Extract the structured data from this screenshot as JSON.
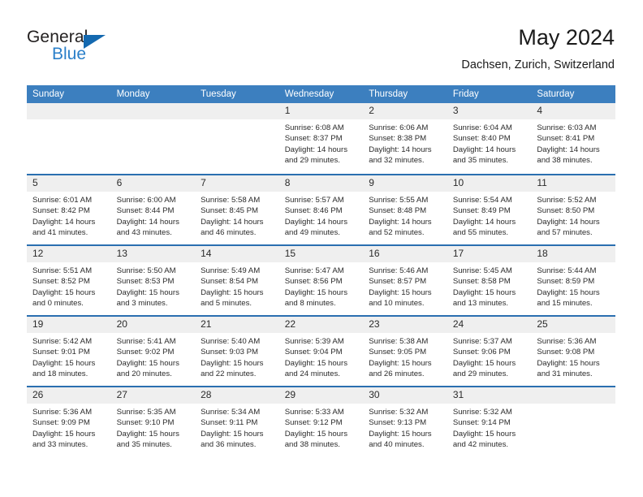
{
  "brand": {
    "name_part1": "General",
    "name_part2": "Blue",
    "accent_color": "#2a7fc9",
    "triangle_color": "#1469b0"
  },
  "header": {
    "title": "May 2024",
    "subtitle": "Dachsen, Zurich, Switzerland"
  },
  "calendar": {
    "header_color": "#3c7fbf",
    "row_divider_color": "#2a6fb0",
    "daynum_bg": "#efefef",
    "weekday_headers": [
      "Sunday",
      "Monday",
      "Tuesday",
      "Wednesday",
      "Thursday",
      "Friday",
      "Saturday"
    ],
    "weeks": [
      [
        {
          "day": "",
          "lines": []
        },
        {
          "day": "",
          "lines": []
        },
        {
          "day": "",
          "lines": []
        },
        {
          "day": "1",
          "lines": [
            "Sunrise: 6:08 AM",
            "Sunset: 8:37 PM",
            "Daylight: 14 hours",
            "and 29 minutes."
          ]
        },
        {
          "day": "2",
          "lines": [
            "Sunrise: 6:06 AM",
            "Sunset: 8:38 PM",
            "Daylight: 14 hours",
            "and 32 minutes."
          ]
        },
        {
          "day": "3",
          "lines": [
            "Sunrise: 6:04 AM",
            "Sunset: 8:40 PM",
            "Daylight: 14 hours",
            "and 35 minutes."
          ]
        },
        {
          "day": "4",
          "lines": [
            "Sunrise: 6:03 AM",
            "Sunset: 8:41 PM",
            "Daylight: 14 hours",
            "and 38 minutes."
          ]
        }
      ],
      [
        {
          "day": "5",
          "lines": [
            "Sunrise: 6:01 AM",
            "Sunset: 8:42 PM",
            "Daylight: 14 hours",
            "and 41 minutes."
          ]
        },
        {
          "day": "6",
          "lines": [
            "Sunrise: 6:00 AM",
            "Sunset: 8:44 PM",
            "Daylight: 14 hours",
            "and 43 minutes."
          ]
        },
        {
          "day": "7",
          "lines": [
            "Sunrise: 5:58 AM",
            "Sunset: 8:45 PM",
            "Daylight: 14 hours",
            "and 46 minutes."
          ]
        },
        {
          "day": "8",
          "lines": [
            "Sunrise: 5:57 AM",
            "Sunset: 8:46 PM",
            "Daylight: 14 hours",
            "and 49 minutes."
          ]
        },
        {
          "day": "9",
          "lines": [
            "Sunrise: 5:55 AM",
            "Sunset: 8:48 PM",
            "Daylight: 14 hours",
            "and 52 minutes."
          ]
        },
        {
          "day": "10",
          "lines": [
            "Sunrise: 5:54 AM",
            "Sunset: 8:49 PM",
            "Daylight: 14 hours",
            "and 55 minutes."
          ]
        },
        {
          "day": "11",
          "lines": [
            "Sunrise: 5:52 AM",
            "Sunset: 8:50 PM",
            "Daylight: 14 hours",
            "and 57 minutes."
          ]
        }
      ],
      [
        {
          "day": "12",
          "lines": [
            "Sunrise: 5:51 AM",
            "Sunset: 8:52 PM",
            "Daylight: 15 hours",
            "and 0 minutes."
          ]
        },
        {
          "day": "13",
          "lines": [
            "Sunrise: 5:50 AM",
            "Sunset: 8:53 PM",
            "Daylight: 15 hours",
            "and 3 minutes."
          ]
        },
        {
          "day": "14",
          "lines": [
            "Sunrise: 5:49 AM",
            "Sunset: 8:54 PM",
            "Daylight: 15 hours",
            "and 5 minutes."
          ]
        },
        {
          "day": "15",
          "lines": [
            "Sunrise: 5:47 AM",
            "Sunset: 8:56 PM",
            "Daylight: 15 hours",
            "and 8 minutes."
          ]
        },
        {
          "day": "16",
          "lines": [
            "Sunrise: 5:46 AM",
            "Sunset: 8:57 PM",
            "Daylight: 15 hours",
            "and 10 minutes."
          ]
        },
        {
          "day": "17",
          "lines": [
            "Sunrise: 5:45 AM",
            "Sunset: 8:58 PM",
            "Daylight: 15 hours",
            "and 13 minutes."
          ]
        },
        {
          "day": "18",
          "lines": [
            "Sunrise: 5:44 AM",
            "Sunset: 8:59 PM",
            "Daylight: 15 hours",
            "and 15 minutes."
          ]
        }
      ],
      [
        {
          "day": "19",
          "lines": [
            "Sunrise: 5:42 AM",
            "Sunset: 9:01 PM",
            "Daylight: 15 hours",
            "and 18 minutes."
          ]
        },
        {
          "day": "20",
          "lines": [
            "Sunrise: 5:41 AM",
            "Sunset: 9:02 PM",
            "Daylight: 15 hours",
            "and 20 minutes."
          ]
        },
        {
          "day": "21",
          "lines": [
            "Sunrise: 5:40 AM",
            "Sunset: 9:03 PM",
            "Daylight: 15 hours",
            "and 22 minutes."
          ]
        },
        {
          "day": "22",
          "lines": [
            "Sunrise: 5:39 AM",
            "Sunset: 9:04 PM",
            "Daylight: 15 hours",
            "and 24 minutes."
          ]
        },
        {
          "day": "23",
          "lines": [
            "Sunrise: 5:38 AM",
            "Sunset: 9:05 PM",
            "Daylight: 15 hours",
            "and 26 minutes."
          ]
        },
        {
          "day": "24",
          "lines": [
            "Sunrise: 5:37 AM",
            "Sunset: 9:06 PM",
            "Daylight: 15 hours",
            "and 29 minutes."
          ]
        },
        {
          "day": "25",
          "lines": [
            "Sunrise: 5:36 AM",
            "Sunset: 9:08 PM",
            "Daylight: 15 hours",
            "and 31 minutes."
          ]
        }
      ],
      [
        {
          "day": "26",
          "lines": [
            "Sunrise: 5:36 AM",
            "Sunset: 9:09 PM",
            "Daylight: 15 hours",
            "and 33 minutes."
          ]
        },
        {
          "day": "27",
          "lines": [
            "Sunrise: 5:35 AM",
            "Sunset: 9:10 PM",
            "Daylight: 15 hours",
            "and 35 minutes."
          ]
        },
        {
          "day": "28",
          "lines": [
            "Sunrise: 5:34 AM",
            "Sunset: 9:11 PM",
            "Daylight: 15 hours",
            "and 36 minutes."
          ]
        },
        {
          "day": "29",
          "lines": [
            "Sunrise: 5:33 AM",
            "Sunset: 9:12 PM",
            "Daylight: 15 hours",
            "and 38 minutes."
          ]
        },
        {
          "day": "30",
          "lines": [
            "Sunrise: 5:32 AM",
            "Sunset: 9:13 PM",
            "Daylight: 15 hours",
            "and 40 minutes."
          ]
        },
        {
          "day": "31",
          "lines": [
            "Sunrise: 5:32 AM",
            "Sunset: 9:14 PM",
            "Daylight: 15 hours",
            "and 42 minutes."
          ]
        },
        {
          "day": "",
          "lines": []
        }
      ]
    ]
  }
}
